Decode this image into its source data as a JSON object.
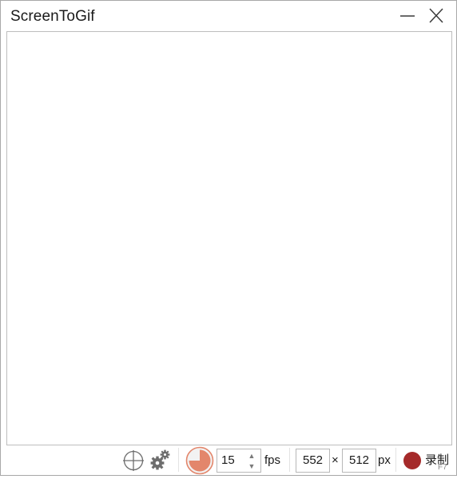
{
  "window": {
    "title": "ScreenToGif"
  },
  "icons": {
    "minimize": "minimize-icon",
    "close": "close-icon",
    "crosshair": "crosshair-icon",
    "settings": "gears-icon",
    "timer": "timer-pie-icon",
    "record": "record-dot-icon"
  },
  "toolbar": {
    "fps_value": "15",
    "fps_unit": "fps",
    "width_value": "552",
    "times_symbol": "×",
    "height_value": "512",
    "size_unit": "px",
    "record_label": "录制",
    "record_shortcut": "F7",
    "spin_up": "▲",
    "spin_down": "▼"
  },
  "colors": {
    "record": "#a52a2a",
    "timer_fill": "#e3866b",
    "timer_bg": "#f2f2f2",
    "icon_gray": "#6d6d6d"
  }
}
